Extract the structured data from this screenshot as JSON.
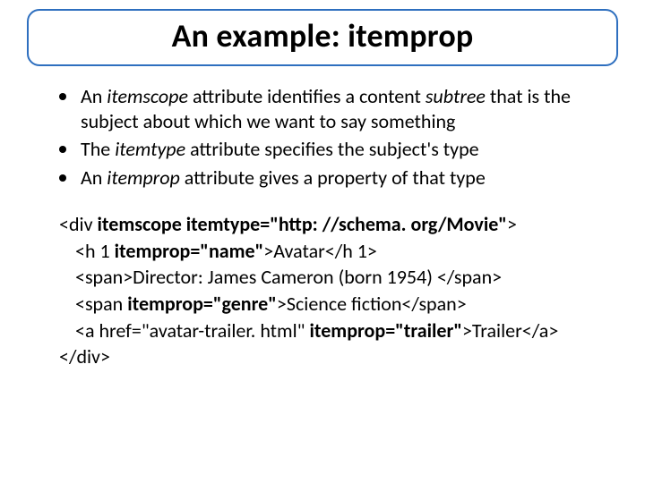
{
  "title": "An example: itemprop",
  "bullets": [
    {
      "pre": "An ",
      "em1": "itemscope",
      "mid1": " attribute identifies a content ",
      "em2": "subtree",
      "post": " that is the subject about which we want to say something"
    },
    {
      "pre": "The ",
      "em1": "itemtype",
      "post": " attribute specifies the subject's type"
    },
    {
      "pre": "An ",
      "em1": "itemprop",
      "post": " attribute gives a property of that type"
    }
  ],
  "code": {
    "l1a": "<div ",
    "l1b": "itemscope itemtype=\"http: //schema. org/Movie\"",
    "l1c": ">",
    "l2a": "<h 1 ",
    "l2b": "itemprop=\"name\"",
    "l2c": ">Avatar</h 1>",
    "l3": "<span>Director: James Cameron (born 1954) </span>",
    "l4a": "<span ",
    "l4b": "itemprop=\"genre\"",
    "l4c": ">Science fiction</span>",
    "l5a": "<a href=\"avatar-trailer. html\" ",
    "l5b": "itemprop=\"trailer\"",
    "l5c": ">Trailer</a>",
    "l6": "</div>"
  }
}
